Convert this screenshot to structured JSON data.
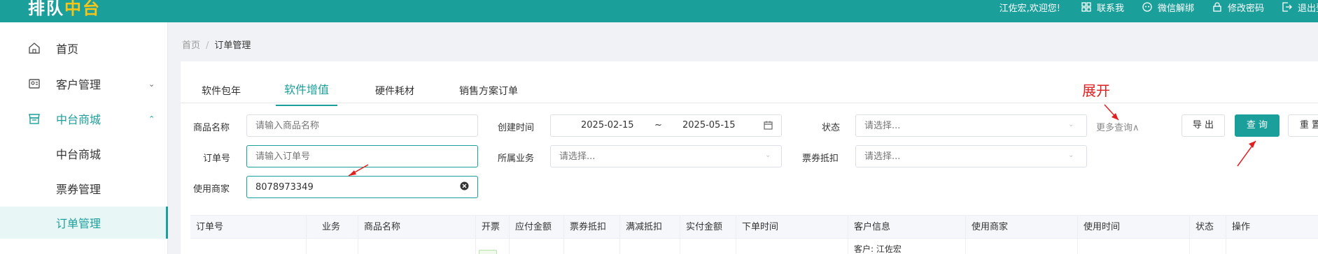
{
  "header": {
    "logo_text_a": "排队",
    "logo_text_b": "中台",
    "welcome": "江佐宏,欢迎您!",
    "links": [
      {
        "label": "联系我",
        "icon": "grid-icon"
      },
      {
        "label": "微信解绑",
        "icon": "wechat-icon"
      },
      {
        "label": "修改密码",
        "icon": "lock-icon"
      },
      {
        "label": "退出登",
        "icon": "logout-icon"
      }
    ]
  },
  "sidebar": {
    "items": [
      {
        "label": "首页",
        "icon": "home-icon"
      },
      {
        "label": "客户管理",
        "icon": "customer-icon",
        "arrow": "⌄"
      },
      {
        "label": "中台商城",
        "icon": "store-icon",
        "arrow": "⌃"
      }
    ],
    "sub_items": [
      {
        "label": "中台商城"
      },
      {
        "label": "票券管理"
      },
      {
        "label": "订单管理"
      }
    ]
  },
  "breadcrumb": {
    "home": "首页",
    "sep": "/",
    "current": "订单管理"
  },
  "tabs": [
    "软件包年",
    "软件增值",
    "硬件耗材",
    "销售方案订单"
  ],
  "filters": {
    "product_name": {
      "label": "商品名称",
      "placeholder": "请输入商品名称"
    },
    "order_no": {
      "label": "订单号",
      "placeholder": "请输入订单号"
    },
    "merchant": {
      "label": "使用商家",
      "value": "8078973349"
    },
    "create_time": {
      "label": "创建时间",
      "start": "2025-02-15",
      "sep": "~",
      "end": "2025-05-15"
    },
    "business": {
      "label": "所属业务",
      "placeholder": "请选择..."
    },
    "status": {
      "label": "状态",
      "placeholder": "请选择..."
    },
    "voucher": {
      "label": "票券抵扣",
      "placeholder": "请选择..."
    }
  },
  "actions": {
    "more": "更多查询∧",
    "export": "导 出",
    "query": "查 询",
    "reset": "重 置"
  },
  "annotation": "展开",
  "table": {
    "columns": [
      "订单号",
      "业务",
      "商品名称",
      "开票",
      "应付金额",
      "票券抵扣",
      "满减抵扣",
      "实付金额",
      "下单时间",
      "客户信息",
      "使用商家",
      "使用时间",
      "状态",
      "操作"
    ],
    "first_row_customer": "客户: 江佐宏"
  },
  "colors": {
    "accent": "#1a9f9b",
    "annotation": "#e02020"
  }
}
